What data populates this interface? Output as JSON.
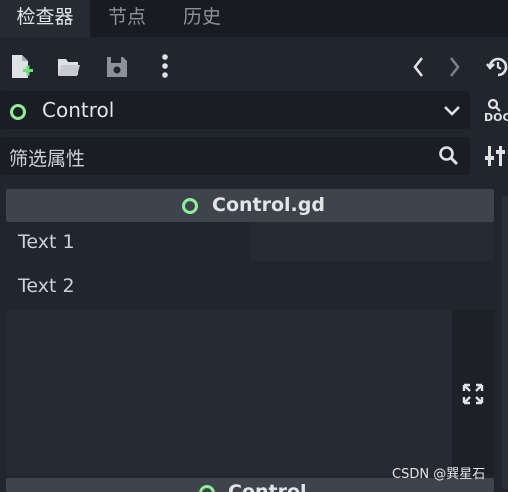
{
  "tabs": [
    {
      "label": "检查器",
      "active": true
    },
    {
      "label": "节点",
      "active": false
    },
    {
      "label": "历史",
      "active": false
    }
  ],
  "toolbar": {
    "icons": [
      "new-resource-icon",
      "open-folder-icon",
      "save-icon",
      "more-vert-icon",
      "back-icon",
      "forward-icon",
      "history-icon"
    ]
  },
  "object_selector": {
    "value": "Control",
    "icon": "circle-node-icon",
    "accent_color": "#8eef97"
  },
  "doc_button": {
    "label": "DOC"
  },
  "filter": {
    "placeholder": "筛选属性"
  },
  "script_section": {
    "title": "Control.gd"
  },
  "properties": [
    {
      "label": "Text 1",
      "value": ""
    },
    {
      "label": "Text 2",
      "value": ""
    }
  ],
  "bottom_section": {
    "title": "Control"
  },
  "watermark": "CSDN @巽星石"
}
